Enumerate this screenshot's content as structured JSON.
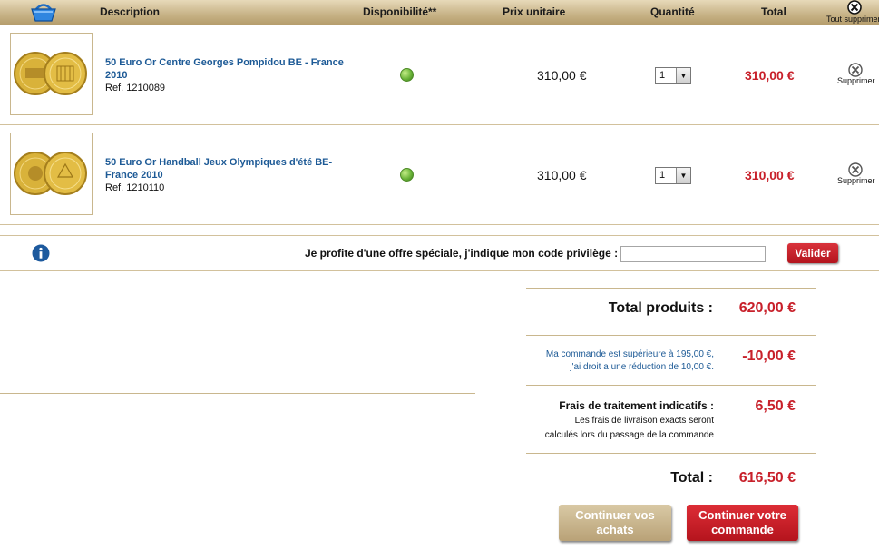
{
  "header": {
    "basket_icon": "shopping-basket-icon",
    "columns": {
      "description": "Description",
      "availability": "Disponibilité**",
      "unit_price": "Prix unitaire",
      "quantity": "Quantité",
      "total": "Total",
      "remove_all": "Tout supprimer"
    }
  },
  "items": [
    {
      "name": "50 Euro Or Centre Georges Pompidou BE - France 2010",
      "ref": "Ref. 1210089",
      "unit_price": "310,00 €",
      "quantity": "1",
      "total": "310,00 €",
      "remove_label": "Supprimer"
    },
    {
      "name": "50 Euro Or Handball Jeux Olympiques d'été BE-France 2010",
      "ref": "Ref. 1210110",
      "unit_price": "310,00 €",
      "quantity": "1",
      "total": "310,00 €",
      "remove_label": "Supprimer"
    }
  ],
  "promo": {
    "label": "Je profite d'une offre spéciale, j'indique mon code privilège :",
    "value": "",
    "submit_label": "Valider"
  },
  "summary": {
    "products_label": "Total produits :",
    "products_value": "620,00 €",
    "discount_line1": "Ma commande est supérieure à 195,00 €,",
    "discount_line2": "j'ai droit a une réduction de 10,00 €.",
    "discount_value": "-10,00 €",
    "fees_label": "Frais de traitement indicatifs :",
    "fees_note_line1": "Les frais de livraison exacts seront",
    "fees_note_line2": "calculés lors du passage de la commande",
    "fees_value": "6,50 €",
    "total_label": "Total :",
    "total_value": "616,50 €"
  },
  "actions": {
    "continue_line1": "Continuer vos",
    "continue_line2": "achats",
    "order_line1": "Continuer votre",
    "order_line2": "commande"
  },
  "colors": {
    "accent_red": "#c8202a",
    "link_blue": "#1d5a96",
    "header_tan": "#c7b286",
    "availability_green": "#6cb53a"
  }
}
